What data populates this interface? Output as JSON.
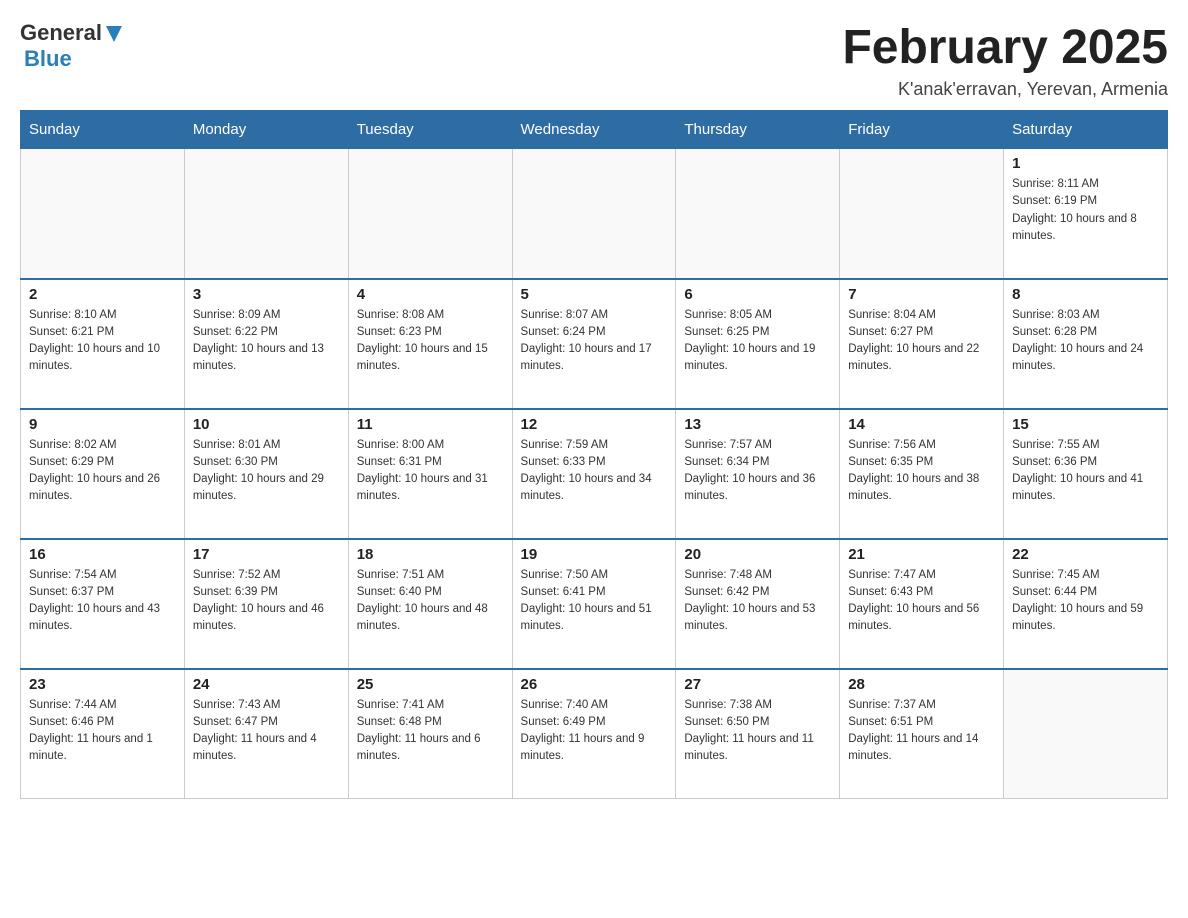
{
  "header": {
    "logo_general": "General",
    "logo_blue": "Blue",
    "month_title": "February 2025",
    "location": "K'anak'erravan, Yerevan, Armenia"
  },
  "days_of_week": [
    "Sunday",
    "Monday",
    "Tuesday",
    "Wednesday",
    "Thursday",
    "Friday",
    "Saturday"
  ],
  "weeks": [
    [
      {
        "day": "",
        "info": ""
      },
      {
        "day": "",
        "info": ""
      },
      {
        "day": "",
        "info": ""
      },
      {
        "day": "",
        "info": ""
      },
      {
        "day": "",
        "info": ""
      },
      {
        "day": "",
        "info": ""
      },
      {
        "day": "1",
        "info": "Sunrise: 8:11 AM\nSunset: 6:19 PM\nDaylight: 10 hours and 8 minutes."
      }
    ],
    [
      {
        "day": "2",
        "info": "Sunrise: 8:10 AM\nSunset: 6:21 PM\nDaylight: 10 hours and 10 minutes."
      },
      {
        "day": "3",
        "info": "Sunrise: 8:09 AM\nSunset: 6:22 PM\nDaylight: 10 hours and 13 minutes."
      },
      {
        "day": "4",
        "info": "Sunrise: 8:08 AM\nSunset: 6:23 PM\nDaylight: 10 hours and 15 minutes."
      },
      {
        "day": "5",
        "info": "Sunrise: 8:07 AM\nSunset: 6:24 PM\nDaylight: 10 hours and 17 minutes."
      },
      {
        "day": "6",
        "info": "Sunrise: 8:05 AM\nSunset: 6:25 PM\nDaylight: 10 hours and 19 minutes."
      },
      {
        "day": "7",
        "info": "Sunrise: 8:04 AM\nSunset: 6:27 PM\nDaylight: 10 hours and 22 minutes."
      },
      {
        "day": "8",
        "info": "Sunrise: 8:03 AM\nSunset: 6:28 PM\nDaylight: 10 hours and 24 minutes."
      }
    ],
    [
      {
        "day": "9",
        "info": "Sunrise: 8:02 AM\nSunset: 6:29 PM\nDaylight: 10 hours and 26 minutes."
      },
      {
        "day": "10",
        "info": "Sunrise: 8:01 AM\nSunset: 6:30 PM\nDaylight: 10 hours and 29 minutes."
      },
      {
        "day": "11",
        "info": "Sunrise: 8:00 AM\nSunset: 6:31 PM\nDaylight: 10 hours and 31 minutes."
      },
      {
        "day": "12",
        "info": "Sunrise: 7:59 AM\nSunset: 6:33 PM\nDaylight: 10 hours and 34 minutes."
      },
      {
        "day": "13",
        "info": "Sunrise: 7:57 AM\nSunset: 6:34 PM\nDaylight: 10 hours and 36 minutes."
      },
      {
        "day": "14",
        "info": "Sunrise: 7:56 AM\nSunset: 6:35 PM\nDaylight: 10 hours and 38 minutes."
      },
      {
        "day": "15",
        "info": "Sunrise: 7:55 AM\nSunset: 6:36 PM\nDaylight: 10 hours and 41 minutes."
      }
    ],
    [
      {
        "day": "16",
        "info": "Sunrise: 7:54 AM\nSunset: 6:37 PM\nDaylight: 10 hours and 43 minutes."
      },
      {
        "day": "17",
        "info": "Sunrise: 7:52 AM\nSunset: 6:39 PM\nDaylight: 10 hours and 46 minutes."
      },
      {
        "day": "18",
        "info": "Sunrise: 7:51 AM\nSunset: 6:40 PM\nDaylight: 10 hours and 48 minutes."
      },
      {
        "day": "19",
        "info": "Sunrise: 7:50 AM\nSunset: 6:41 PM\nDaylight: 10 hours and 51 minutes."
      },
      {
        "day": "20",
        "info": "Sunrise: 7:48 AM\nSunset: 6:42 PM\nDaylight: 10 hours and 53 minutes."
      },
      {
        "day": "21",
        "info": "Sunrise: 7:47 AM\nSunset: 6:43 PM\nDaylight: 10 hours and 56 minutes."
      },
      {
        "day": "22",
        "info": "Sunrise: 7:45 AM\nSunset: 6:44 PM\nDaylight: 10 hours and 59 minutes."
      }
    ],
    [
      {
        "day": "23",
        "info": "Sunrise: 7:44 AM\nSunset: 6:46 PM\nDaylight: 11 hours and 1 minute."
      },
      {
        "day": "24",
        "info": "Sunrise: 7:43 AM\nSunset: 6:47 PM\nDaylight: 11 hours and 4 minutes."
      },
      {
        "day": "25",
        "info": "Sunrise: 7:41 AM\nSunset: 6:48 PM\nDaylight: 11 hours and 6 minutes."
      },
      {
        "day": "26",
        "info": "Sunrise: 7:40 AM\nSunset: 6:49 PM\nDaylight: 11 hours and 9 minutes."
      },
      {
        "day": "27",
        "info": "Sunrise: 7:38 AM\nSunset: 6:50 PM\nDaylight: 11 hours and 11 minutes."
      },
      {
        "day": "28",
        "info": "Sunrise: 7:37 AM\nSunset: 6:51 PM\nDaylight: 11 hours and 14 minutes."
      },
      {
        "day": "",
        "info": ""
      }
    ]
  ]
}
